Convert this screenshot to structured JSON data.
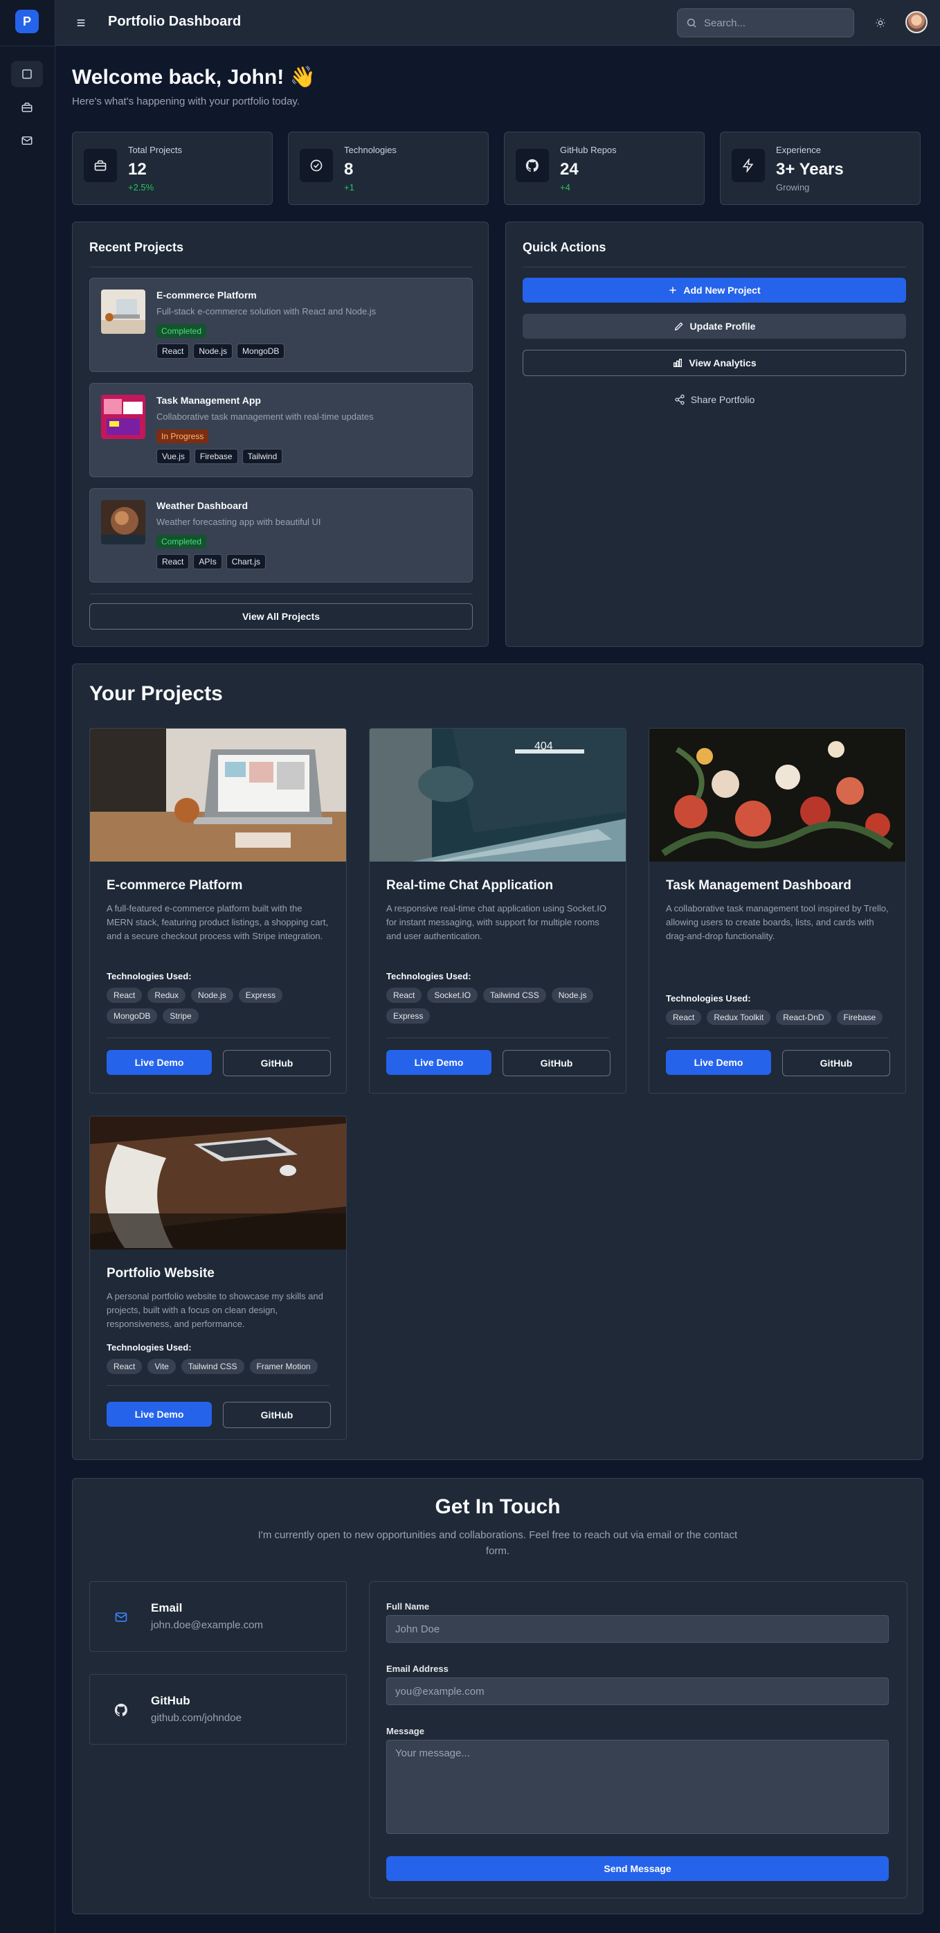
{
  "app": {
    "logo_letter": "P",
    "title": "Portfolio Dashboard"
  },
  "search": {
    "placeholder": "Search..."
  },
  "sidebar": {
    "items": [
      {
        "name": "dashboard",
        "icon": "square-icon"
      },
      {
        "name": "projects",
        "icon": "briefcase-icon"
      },
      {
        "name": "messages",
        "icon": "mail-icon"
      }
    ]
  },
  "welcome": {
    "title": "Welcome back, John! 👋",
    "subtitle": "Here's what's happening with your portfolio today."
  },
  "stats": [
    {
      "label": "Total Projects",
      "value": "12",
      "delta": "+2.5%",
      "icon": "briefcase-icon"
    },
    {
      "label": "Technologies",
      "value": "8",
      "delta": "+1",
      "icon": "check-circle-icon"
    },
    {
      "label": "GitHub Repos",
      "value": "24",
      "delta": "+4",
      "icon": "github-icon"
    },
    {
      "label": "Experience",
      "value": "3+ Years",
      "delta": "Growing",
      "icon": "zap-icon"
    }
  ],
  "recent": {
    "title": "Recent Projects",
    "items": [
      {
        "name": "E-commerce Platform",
        "desc": "Full-stack e-commerce solution with React and Node.js",
        "status": "Completed",
        "tags": [
          "React",
          "Node.js",
          "MongoDB"
        ]
      },
      {
        "name": "Task Management App",
        "desc": "Collaborative task management with real-time updates",
        "status": "In Progress",
        "tags": [
          "Vue.js",
          "Firebase",
          "Tailwind"
        ]
      },
      {
        "name": "Weather Dashboard",
        "desc": "Weather forecasting app with beautiful UI",
        "status": "Completed",
        "tags": [
          "React",
          "APIs",
          "Chart.js"
        ]
      }
    ],
    "view_all": "View All Projects"
  },
  "quick": {
    "title": "Quick Actions",
    "add": "Add New Project",
    "update": "Update Profile",
    "analytics": "View Analytics",
    "share": "Share Portfolio"
  },
  "projects": {
    "title": "Your Projects",
    "tech_label": "Technologies Used:",
    "demo_label": "Live Demo",
    "github_label": "GitHub",
    "cards": [
      {
        "title": "E-commerce Platform",
        "desc": "A full-featured e-commerce platform built with the MERN stack, featuring product listings, a shopping cart, and a secure checkout process with Stripe integration.",
        "tags": [
          "React",
          "Redux",
          "Node.js",
          "Express",
          "MongoDB",
          "Stripe"
        ]
      },
      {
        "title": "Real-time Chat Application",
        "desc": "A responsive real-time chat application using Socket.IO for instant messaging, with support for multiple rooms and user authentication.",
        "tags": [
          "React",
          "Socket.IO",
          "Tailwind CSS",
          "Node.js",
          "Express"
        ]
      },
      {
        "title": "Task Management Dashboard",
        "desc": "A collaborative task management tool inspired by Trello, allowing users to create boards, lists, and cards with drag-and-drop functionality.",
        "tags": [
          "React",
          "Redux Toolkit",
          "React-DnD",
          "Firebase"
        ]
      },
      {
        "title": "Portfolio Website",
        "desc": "A personal portfolio website to showcase my skills and projects, built with a focus on clean design, responsiveness, and performance.",
        "tags": [
          "React",
          "Vite",
          "Tailwind CSS",
          "Framer Motion"
        ]
      }
    ],
    "chat_img_text": "404"
  },
  "contact": {
    "title": "Get In Touch",
    "subtitle": "I'm currently open to new opportunities and collaborations. Feel free to reach out via email or the contact form.",
    "email_label": "Email",
    "email_value": "john.doe@example.com",
    "github_label": "GitHub",
    "github_value": "github.com/johndoe",
    "form": {
      "name_label": "Full Name",
      "name_placeholder": "John Doe",
      "email_label": "Email Address",
      "email_placeholder": "you@example.com",
      "message_label": "Message",
      "message_placeholder": "Your message...",
      "submit": "Send Message"
    }
  },
  "colors": {
    "accent": "#2563eb",
    "bg": "#0f172a",
    "panel": "#1f2937",
    "success": "#22c55e",
    "warning": "#fdba74"
  }
}
